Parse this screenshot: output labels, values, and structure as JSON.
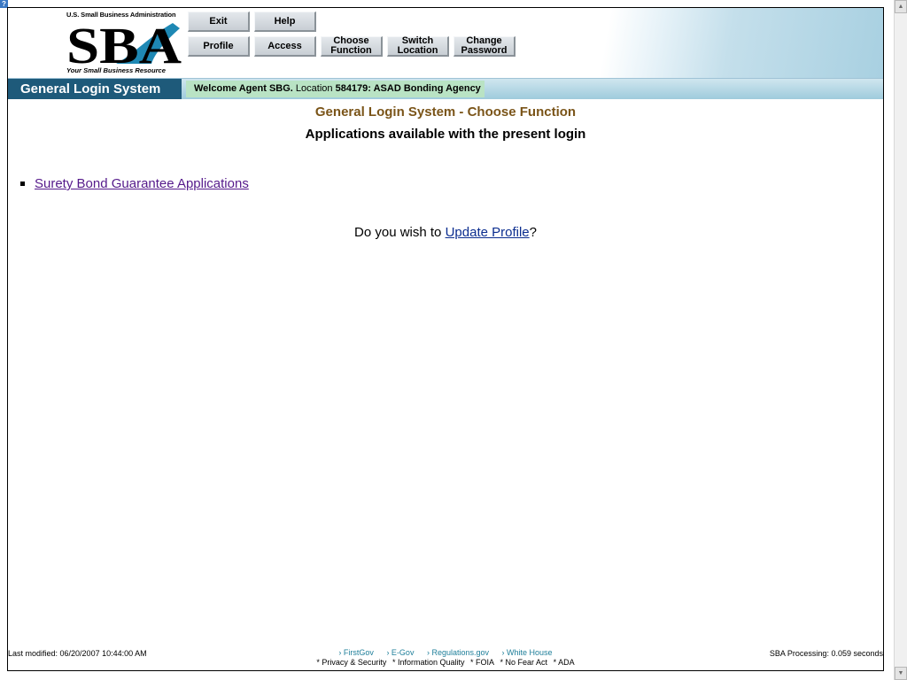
{
  "logo": {
    "agency": "U.S. Small Business Administration",
    "letters": "SBA",
    "tagline": "Your Small Business Resource"
  },
  "toolbar": {
    "exit": "Exit",
    "help": "Help",
    "profile": "Profile",
    "access": "Access",
    "choose_function": "Choose\nFunction",
    "switch_location": "Switch\nLocation",
    "change_password": "Change\nPassword"
  },
  "nav": {
    "system_title": "General Login System",
    "welcome": "Welcome Agent SBG.",
    "location_label": "Location",
    "location_value": "584179: ASAD Bonding Agency"
  },
  "main": {
    "heading": "General Login System - Choose Function",
    "subheading": "Applications available with the present login",
    "applications": [
      "Surety Bond Guarantee Applications"
    ],
    "update_prefix": "Do you wish to",
    "update_link": "Update Profile",
    "update_suffix": "?"
  },
  "footer": {
    "last_modified": "Last modified: 06/20/2007 10:44:00 AM",
    "links": [
      "› FirstGov",
      "› E-Gov",
      "› Regulations.gov",
      "› White House"
    ],
    "links2": [
      "* Privacy & Security",
      "* Information Quality",
      "* FOIA",
      "* No Fear Act",
      "* ADA"
    ],
    "processing": "SBA Processing:  0.059 seconds"
  },
  "colors": {
    "nav_title_bg": "#1e5a7a",
    "heading": "#7a5418",
    "visited_link": "#551a8b",
    "link": "#0b2d8f",
    "footer_link": "#1f7f9a"
  }
}
